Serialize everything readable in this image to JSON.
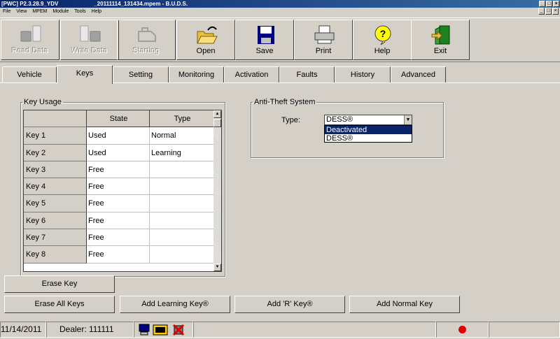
{
  "window": {
    "app_name": "[PWC] P2.3.28.9_YDV",
    "file_title": "_20111114_131434.mpem - B.U.D.S."
  },
  "menu": [
    "File",
    "View",
    "MPEM",
    "Module",
    "Tools",
    "Help"
  ],
  "toolbar": {
    "read_data": "Read Data",
    "write_data": "Write Data",
    "starting": "Starting",
    "open": "Open",
    "save": "Save",
    "print": "Print",
    "help": "Help",
    "exit": "Exit"
  },
  "tabs": [
    "Vehicle",
    "Keys",
    "Setting",
    "Monitoring",
    "Activation",
    "Faults",
    "History",
    "Advanced"
  ],
  "active_tab": "Keys",
  "key_usage": {
    "legend": "Key Usage",
    "headers": [
      "",
      "State",
      "Type"
    ],
    "rows": [
      [
        "Key 1",
        "Used",
        "Normal"
      ],
      [
        "Key 2",
        "Used",
        "Learning"
      ],
      [
        "Key 3",
        "Free",
        ""
      ],
      [
        "Key 4",
        "Free",
        ""
      ],
      [
        "Key 5",
        "Free",
        ""
      ],
      [
        "Key 6",
        "Free",
        ""
      ],
      [
        "Key 7",
        "Free",
        ""
      ],
      [
        "Key 8",
        "Free",
        ""
      ]
    ]
  },
  "anti_theft": {
    "legend": "Anti-Theft System",
    "type_label": "Type:",
    "selected": "DESS®",
    "options": [
      "Deactivated",
      "DESS®"
    ],
    "highlighted_option": "Deactivated"
  },
  "buttons": {
    "erase_key": "Erase Key",
    "erase_all_keys": "Erase All Keys",
    "add_learning_key": "Add Learning Key®",
    "add_r_key": "Add 'R' Key®",
    "add_normal_key": "Add Normal Key"
  },
  "status": {
    "date": "11/14/2011",
    "dealer": "Dealer: 111111",
    "connection_color": "#e00000"
  }
}
